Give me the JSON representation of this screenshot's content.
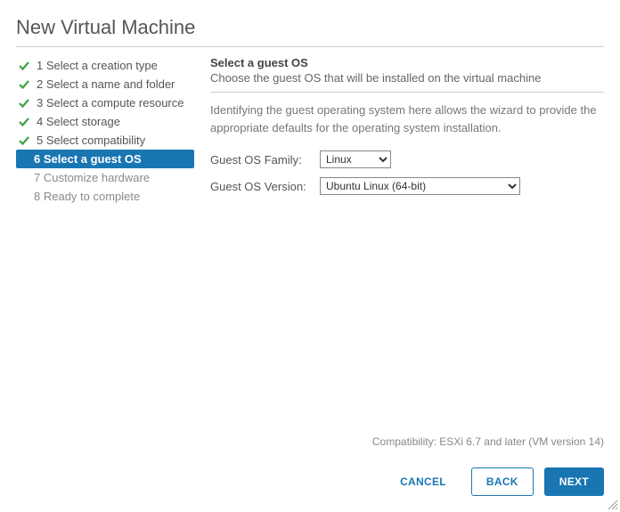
{
  "title": "New Virtual Machine",
  "steps": [
    {
      "label": "1 Select a creation type",
      "state": "done"
    },
    {
      "label": "2 Select a name and folder",
      "state": "done"
    },
    {
      "label": "3 Select a compute resource",
      "state": "done"
    },
    {
      "label": "4 Select storage",
      "state": "done"
    },
    {
      "label": "5 Select compatibility",
      "state": "done"
    },
    {
      "label": "6 Select a guest OS",
      "state": "active"
    },
    {
      "label": "7 Customize hardware",
      "state": "future"
    },
    {
      "label": "8 Ready to complete",
      "state": "future"
    }
  ],
  "section": {
    "title": "Select a guest OS",
    "subtitle": "Choose the guest OS that will be installed on the virtual machine",
    "help": "Identifying the guest operating system here allows the wizard to provide the appropriate defaults for the operating system installation."
  },
  "fields": {
    "family_label": "Guest OS Family:",
    "family_value": "Linux",
    "version_label": "Guest OS Version:",
    "version_value": "Ubuntu Linux (64-bit)"
  },
  "footer": {
    "compat": "Compatibility: ESXi 6.7 and later (VM version 14)",
    "cancel": "CANCEL",
    "back": "BACK",
    "next": "NEXT"
  }
}
